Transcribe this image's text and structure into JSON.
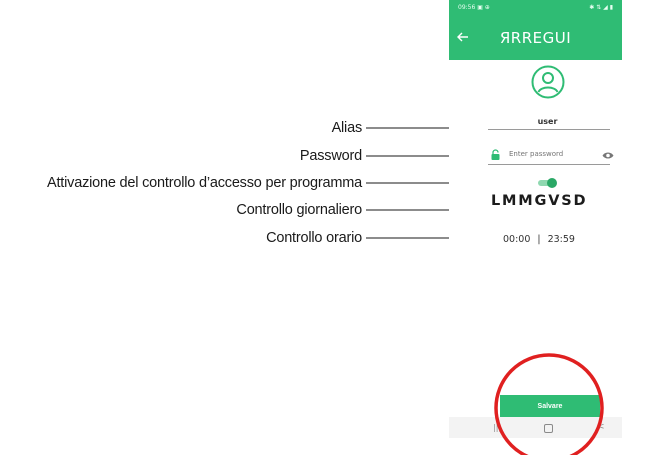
{
  "annotations": [
    {
      "key": "alias",
      "label": "Alias"
    },
    {
      "key": "password",
      "label": "Password"
    },
    {
      "key": "access_control",
      "label": "Attivazione del controllo d’accesso per programma"
    },
    {
      "key": "daily",
      "label": "Controllo giornaliero"
    },
    {
      "key": "hourly",
      "label": "Controllo orario"
    }
  ],
  "phone": {
    "status_bar": {
      "time": "09:56 ▣ ⊕",
      "icons": "✱ ⇅ ◢ ▮"
    },
    "app_bar": {
      "logo": "ЯRREGUI",
      "back_icon": "arrow-left-icon"
    },
    "avatar_icon": "user-circle-icon",
    "alias": {
      "value": "user"
    },
    "password": {
      "placeholder": "Enter password",
      "lock_icon": "lock-icon",
      "visibility_icon": "eye-icon"
    },
    "access_toggle": {
      "state": "on"
    },
    "days": [
      "L",
      "M",
      "M",
      "G",
      "V",
      "S",
      "D"
    ],
    "hours": {
      "from": "00:00",
      "separator": "|",
      "to": "23:59"
    },
    "save_button": {
      "label": "Salvare"
    },
    "nav_bar": {
      "recent": "|||",
      "home_icon": "home-icon",
      "back": "<"
    }
  },
  "colors": {
    "accent": "#2fbc74",
    "highlight": "#e02020"
  }
}
